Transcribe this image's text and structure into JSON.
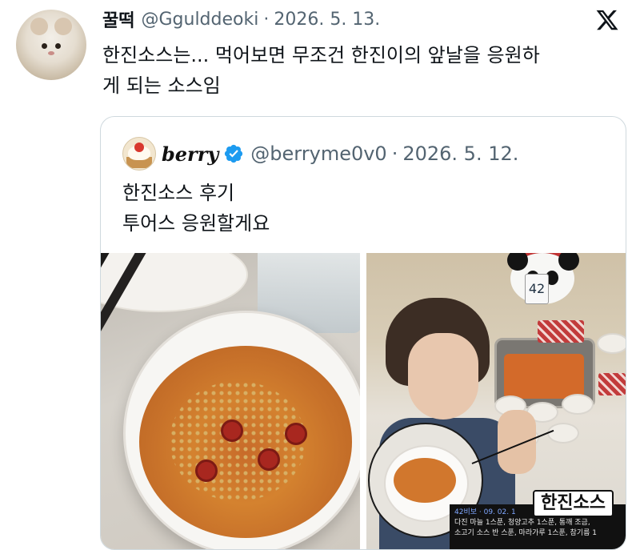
{
  "tweet": {
    "display_name": "꿀떡",
    "handle": "@Ggulddeoki",
    "separator": "·",
    "date": "2026. 5. 13.",
    "text_line1": "한진소스는... 먹어보면 무조건 한진이의 앞날을 응원하",
    "text_line2": "게 되는 소스임"
  },
  "quote": {
    "display_name": "berry",
    "handle": "@berryme0v0",
    "separator": "·",
    "date": "2026. 5. 12.",
    "text_line1": "한진소스 후기",
    "text_line2": "투어스 응원할게요"
  },
  "photo2": {
    "number_card": "42",
    "label": "한진소스",
    "memo_head": "42비보 · 09. 02. 1",
    "memo_line1": "다진 마늘 1스푼, 청양고추 1스푼, 통깨 조금,",
    "memo_line2": "소고기 소스 반 스푼, 마라가루 1스푼, 참기름 1"
  },
  "colors": {
    "text": "#0f1419",
    "secondary": "#536471",
    "border": "#cfd9de",
    "verified": "#1d9bf0"
  },
  "icons": {
    "brand": "x-logo-icon",
    "verified": "verified-badge-icon"
  }
}
